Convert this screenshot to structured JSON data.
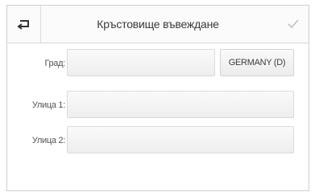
{
  "header": {
    "title": "Кръстовище въвеждане",
    "back_icon": "back-return-icon",
    "confirm_icon": "checkmark-icon"
  },
  "form": {
    "city_label": "Град:",
    "city_value": "",
    "country_button_label": "GERMANY (D)",
    "street1_label": "Улица 1:",
    "street1_value": "",
    "street2_label": "Улица 2:",
    "street2_value": ""
  }
}
